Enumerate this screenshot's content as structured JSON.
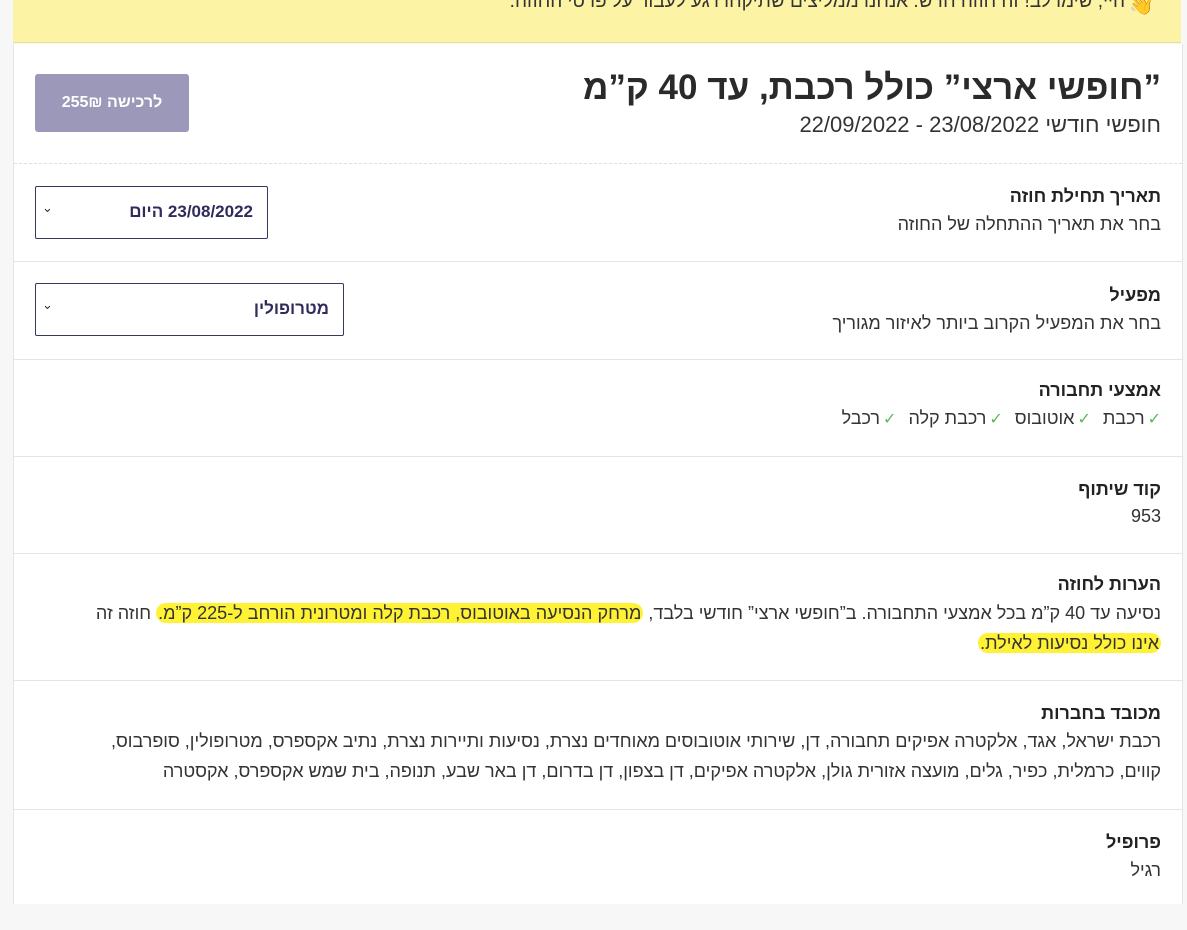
{
  "banner": {
    "icon": "waving-hand-icon",
    "text": "היי, שימו לב! זה חוזה חדש. אנחנו ממליצים שתיקחו רגע לעבור על פרטי החוזה."
  },
  "header": {
    "title": "”חופשי ארצי” כולל רכבת, עד 40 ק”מ",
    "subtitle": "חופשי חודשי 23/08/2022 - 22/09/2022",
    "buy_label": "לרכישה 255₪"
  },
  "start_date": {
    "label": "תאריך תחילת חוזה",
    "description": "בחר את תאריך ההתחלה של החוזה",
    "value": "23/08/2022 היום"
  },
  "operator": {
    "label": "מפעיל",
    "description": "בחר את המפעיל הקרוב ביותר לאיזור מגוריך",
    "value": "מטרופולין"
  },
  "transport": {
    "label": "אמצעי תחבורה",
    "modes": [
      "רכבת",
      "אוטובוס",
      "רכבת קלה",
      "רכבל"
    ]
  },
  "share_code": {
    "label": "קוד שיתוף",
    "value": "953"
  },
  "notes": {
    "label": "הערות לחוזה",
    "text_part1": "נסיעה עד 40 ק”מ בכל אמצעי התחבורה. ב”חופשי ארצי” חודשי בלבד, ",
    "text_highlight1": "מרחק הנסיעה באוטובוס, רכבת קלה ומטרונית הורחב ל-225 ק”מ.",
    "text_part2": " חוזה זה ",
    "text_highlight2": "אינו כולל נסיעות לאילת."
  },
  "companies": {
    "label": "מכובד בחברות",
    "line1": "רכבת ישראל, אגד, אלקטרה אפיקים תחבורה, דן, שירותי אוטובוסים מאוחדים נצרת, נסיעות ותיירות נצרת, נתיב אקספרס, מטרופולין, סופרבוס,",
    "line2": "קווים, כרמלית, כפיר, גלים, מועצה אזורית גולן, אלקטרה אפיקים, דן בצפון, דן בדרום, דן באר שבע, תנופה, בית שמש אקספרס, אקסטרה"
  },
  "profile": {
    "label": "פרופיל",
    "value": "רגיל"
  }
}
